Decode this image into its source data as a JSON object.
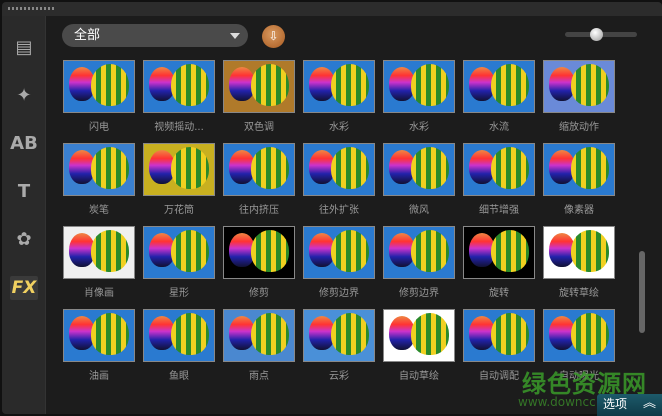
{
  "toolbar": {
    "category": "全部",
    "options_label": "选项",
    "zoom_level": 0.45
  },
  "sidebar": [
    {
      "name": "media",
      "glyph": "▤"
    },
    {
      "name": "transition",
      "glyph": "✦"
    },
    {
      "name": "title",
      "glyph": "AB"
    },
    {
      "name": "text",
      "glyph": "T"
    },
    {
      "name": "graphic",
      "glyph": "✿"
    },
    {
      "name": "fx",
      "glyph": "FX",
      "active": true
    }
  ],
  "effects": [
    {
      "label": "闪电",
      "bg": "#2a7ad0"
    },
    {
      "label": "视频摇动...",
      "bg": "#2a7ad0"
    },
    {
      "label": "双色调",
      "bg": "#b07a2a"
    },
    {
      "label": "水彩",
      "bg": "#2a7ad0"
    },
    {
      "label": "水彩",
      "bg": "#2a7ad0"
    },
    {
      "label": "水流",
      "bg": "#2a7ad0"
    },
    {
      "label": "缩放动作",
      "bg": "#6a8ad8"
    },
    {
      "label": "炭笔",
      "bg": "#3a80d0"
    },
    {
      "label": "万花筒",
      "bg": "#c8b020"
    },
    {
      "label": "往内挤压",
      "bg": "#2a7ad0"
    },
    {
      "label": "往外扩张",
      "bg": "#2a7ad0"
    },
    {
      "label": "微风",
      "bg": "#2a7ad0"
    },
    {
      "label": "细节增强",
      "bg": "#2a7ad0"
    },
    {
      "label": "像素器",
      "bg": "#2a7ad0"
    },
    {
      "label": "肖像画",
      "bg": "#f0f0f0"
    },
    {
      "label": "星形",
      "bg": "#2a7ad0"
    },
    {
      "label": "修剪",
      "bg": "#000000"
    },
    {
      "label": "修剪边界",
      "bg": "#2a7ad0"
    },
    {
      "label": "修剪边界",
      "bg": "#2a7ad0"
    },
    {
      "label": "旋转",
      "bg": "#000000"
    },
    {
      "label": "旋转草绘",
      "bg": "#ffffff"
    },
    {
      "label": "油画",
      "bg": "#2a7ad0"
    },
    {
      "label": "鱼眼",
      "bg": "#2a7ad0"
    },
    {
      "label": "雨点",
      "bg": "#4a88d0"
    },
    {
      "label": "云彩",
      "bg": "#4a90d8"
    },
    {
      "label": "自动草绘",
      "bg": "#ffffff"
    },
    {
      "label": "自动调配",
      "bg": "#2a7ad0"
    },
    {
      "label": "自动曝光",
      "bg": "#2a7ad0"
    }
  ],
  "watermark": {
    "text": "绿色资源网",
    "url": "www.downcc.com"
  }
}
